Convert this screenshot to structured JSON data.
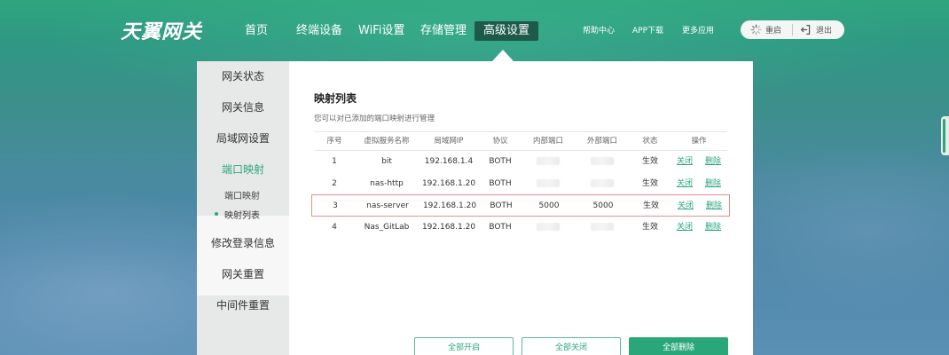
{
  "brand": {
    "logo_text": "天翼网关"
  },
  "nav": {
    "items": [
      {
        "label": "首页"
      },
      {
        "label": "终端设备"
      },
      {
        "label": "WiFi设置"
      },
      {
        "label": "存储管理"
      },
      {
        "label": "高级设置"
      }
    ],
    "active_index": 4
  },
  "utility_links": [
    {
      "label": "帮助中心"
    },
    {
      "label": "APP下载"
    },
    {
      "label": "更多应用"
    }
  ],
  "actions": {
    "restart_label": "重启",
    "logout_label": "退出"
  },
  "sidebar": {
    "items": [
      {
        "label": "网关状态"
      },
      {
        "label": "网关信息"
      },
      {
        "label": "局域网设置"
      },
      {
        "label": "端口映射"
      },
      {
        "label": "修改登录信息"
      },
      {
        "label": "网关重置"
      },
      {
        "label": "中间件重置"
      }
    ],
    "sub_items": [
      {
        "label": "端口映射"
      },
      {
        "label": "映射列表"
      }
    ],
    "active_sub_index": 1
  },
  "panel": {
    "title": "映射列表",
    "description": "您可以对已添加的端口映射进行管理"
  },
  "table": {
    "headers": [
      "序号",
      "虚拟服务名称",
      "局域网IP",
      "协议",
      "内部端口",
      "外部端口",
      "状态",
      "操作"
    ],
    "rows": [
      {
        "index": "1",
        "name": "bit",
        "ip": "192.168.1.4",
        "protocol": "BOTH",
        "internal_port": "",
        "external_port": "",
        "status": "生效",
        "action_close": "关闭",
        "action_delete": "删除"
      },
      {
        "index": "2",
        "name": "nas-http",
        "ip": "192.168.1.20",
        "protocol": "BOTH",
        "internal_port": "",
        "external_port": "",
        "status": "生效",
        "action_close": "关闭",
        "action_delete": "删除"
      },
      {
        "index": "3",
        "name": "nas-server",
        "ip": "192.168.1.20",
        "protocol": "BOTH",
        "internal_port": "5000",
        "external_port": "5000",
        "status": "生效",
        "action_close": "关闭",
        "action_delete": "删除"
      },
      {
        "index": "4",
        "name": "Nas_GitLab",
        "ip": "192.168.1.20",
        "protocol": "BOTH",
        "internal_port": "",
        "external_port": "",
        "status": "生效",
        "action_close": "关闭",
        "action_delete": "删除"
      }
    ],
    "highlighted_row": 2,
    "colors": {
      "accent": "#2aa77a",
      "highlight_border": "#e4908a"
    }
  },
  "buttons": {
    "enable_all": "全部开启",
    "disable_all": "全部关闭",
    "delete_all": "全部删除"
  }
}
